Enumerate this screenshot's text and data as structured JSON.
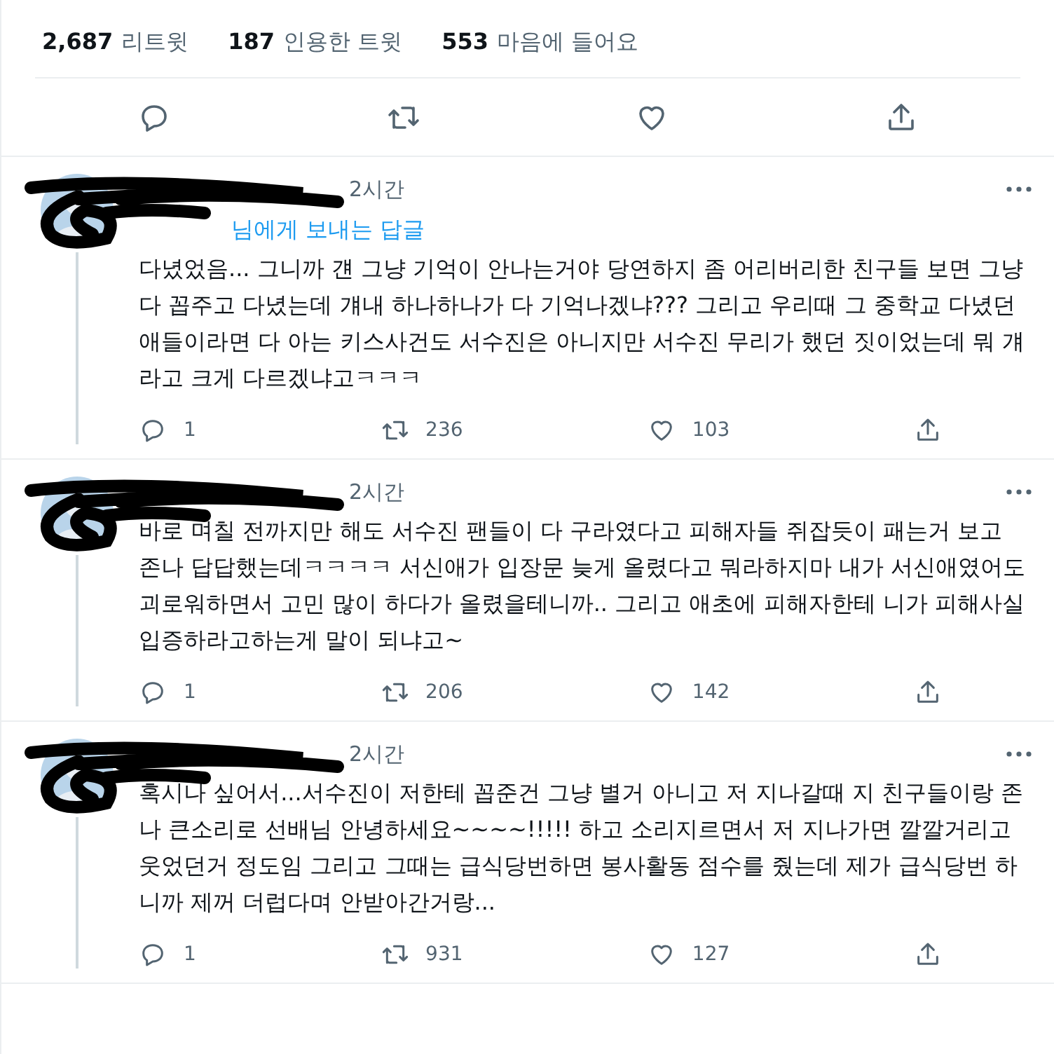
{
  "stats": [
    {
      "count": "2,687",
      "label": "리트윗"
    },
    {
      "count": "187",
      "label": "인용한 트윗"
    },
    {
      "count": "553",
      "label": "마음에 들어요"
    }
  ],
  "actions": [
    {
      "kind": "reply"
    },
    {
      "kind": "retweet"
    },
    {
      "kind": "like"
    },
    {
      "kind": "share"
    }
  ],
  "replies": [
    {
      "time": "2시간",
      "reply_to": "님에게 보내는 답글",
      "text": "다녔었음... 그니까 걘 그냥 기억이 안나는거야 당연하지 좀 어리버리한 친구들 보면 그냥 다 꼽주고 다녔는데 걔내 하나하나가 다 기억나겠냐??? 그리고 우리때 그 중학교 다녔던 애들이라면 다 아는 키스사건도 서수진은 아니지만 서수진 무리가 했던 짓이었는데 뭐 걔라고 크게 다르겠냐고ㅋㅋㅋ",
      "replies": "1",
      "retweets": "236",
      "likes": "103"
    },
    {
      "time": "2시간",
      "text": "바로 며칠 전까지만 해도 서수진 팬들이 다 구라였다고 피해자들 쥐잡듯이 패는거 보고 존나 답답했는데ㅋㅋㅋㅋ 서신애가 입장문 늦게 올렸다고 뭐라하지마 내가 서신애였어도 괴로워하면서 고민 많이 하다가 올렸을테니까.. 그리고 애초에 피해자한테 니가 피해사실 입증하라고하는게 말이 되냐고~",
      "replies": "1",
      "retweets": "206",
      "likes": "142"
    },
    {
      "time": "2시간",
      "text": "혹시나 싶어서...서수진이 저한테 꼽준건 그냥 별거 아니고 저 지나갈때 지 친구들이랑 존나 큰소리로 선배님 안녕하세요~~~~!!!!! 하고 소리지르면서 저 지나가면 깔깔거리고 웃었던거 정도임 그리고 그때는 급식당번하면 봉사활동 점수를 줬는데 제가 급식당번 하니까 제꺼 더럽다며 안받아간거랑...",
      "replies": "1",
      "retweets": "931",
      "likes": "127"
    }
  ]
}
